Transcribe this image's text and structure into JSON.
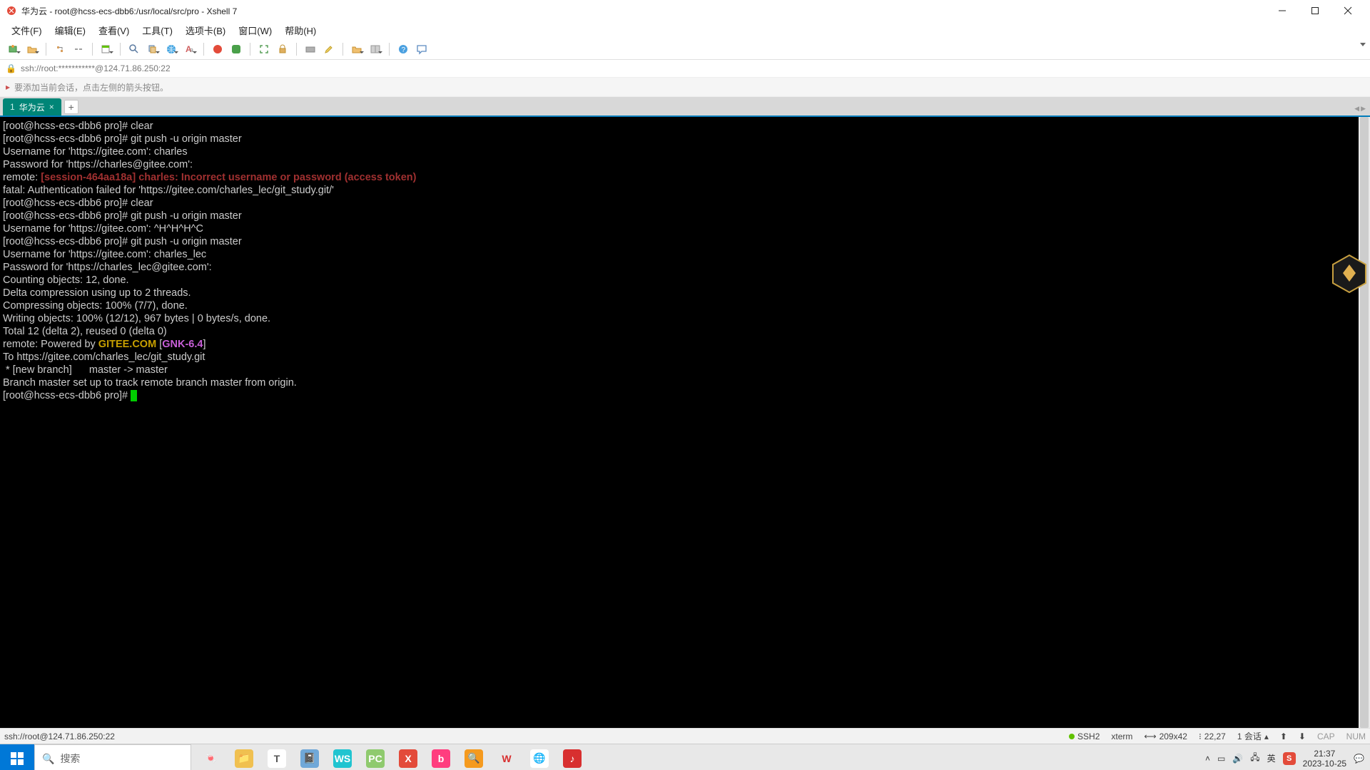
{
  "window": {
    "title": "华为云 - root@hcss-ecs-dbb6:/usr/local/src/pro - Xshell 7"
  },
  "menu": {
    "file": "文件(F)",
    "edit": "编辑(E)",
    "view": "查看(V)",
    "tools": "工具(T)",
    "tabs": "选项卡(B)",
    "window": "窗口(W)",
    "help": "帮助(H)"
  },
  "addr": {
    "text": "ssh://root:***********@124.71.86.250:22"
  },
  "hint": {
    "text": "要添加当前会话，点击左侧的箭头按钮。"
  },
  "tab": {
    "num": "1",
    "label": "华为云",
    "new": "+"
  },
  "term": {
    "l01": "[root@hcss-ecs-dbb6 pro]# clear",
    "l02": "[root@hcss-ecs-dbb6 pro]# git push -u origin master",
    "l03": "Username for 'https://gitee.com': charles",
    "l04": "Password for 'https://charles@gitee.com':",
    "l05_prefix": "remote: ",
    "l05_err": "[session-464aa18a] charles: Incorrect username or password (access token)",
    "l06": "fatal: Authentication failed for 'https://gitee.com/charles_lec/git_study.git/'",
    "l07": "[root@hcss-ecs-dbb6 pro]# clear",
    "l08": "[root@hcss-ecs-dbb6 pro]# git push -u origin master",
    "l09": "Username for 'https://gitee.com': ^H^H^H^C",
    "l10": "[root@hcss-ecs-dbb6 pro]# git push -u origin master",
    "l11": "Username for 'https://gitee.com': charles_lec",
    "l12": "Password for 'https://charles_lec@gitee.com':",
    "l13": "Counting objects: 12, done.",
    "l14": "Delta compression using up to 2 threads.",
    "l15": "Compressing objects: 100% (7/7), done.",
    "l16": "Writing objects: 100% (12/12), 967 bytes | 0 bytes/s, done.",
    "l17": "Total 12 (delta 2), reused 0 (delta 0)",
    "l18_prefix": "remote: Powered by ",
    "l18_gitee": "GITEE.COM",
    "l18_lb": " [",
    "l18_gnk": "GNK-6.4",
    "l18_rb": "]",
    "l19": "To https://gitee.com/charles_lec/git_study.git",
    "l20": " * [new branch]      master -> master",
    "l21": "Branch master set up to track remote branch master from origin.",
    "l22": "[root@hcss-ecs-dbb6 pro]# "
  },
  "status": {
    "left": "ssh://root@124.71.86.250:22",
    "ssh": "SSH2",
    "xterm": "xterm",
    "dims": "209x42",
    "pos": "22,27",
    "sess": "1 会话",
    "cap": "CAP",
    "num": "NUM"
  },
  "task": {
    "search": "搜索",
    "time": "21:37",
    "date": "2023-10-25",
    "ime": "英"
  }
}
